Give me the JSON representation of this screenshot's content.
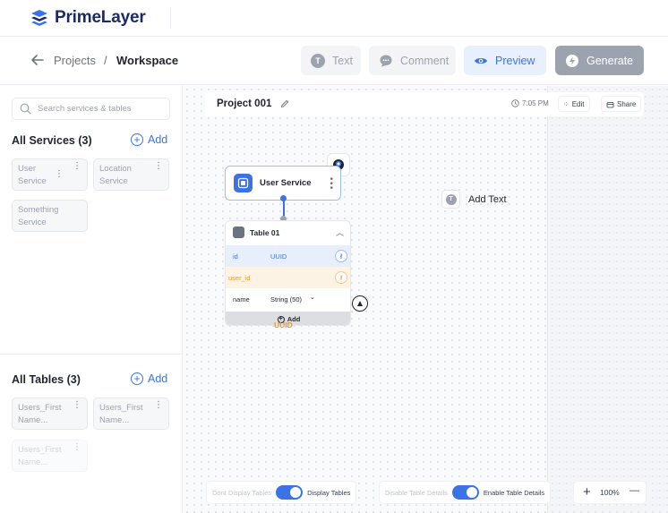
{
  "app": {
    "name": "PrimeLayer"
  },
  "breadcrumb": {
    "projects": "Projects",
    "separator": "/",
    "current": "Workspace"
  },
  "toolbar": {
    "text_label": "Text",
    "comment_label": "Comment",
    "preview_label": "Preview",
    "generate_label": "Generate"
  },
  "sidebar": {
    "search_placeholder": "Search services & tables",
    "services_title": "All Services (3)",
    "services_add": "Add",
    "services": [
      {
        "line1": "User",
        "line2": "Service"
      },
      {
        "line1": "Location",
        "line2": "Service"
      },
      {
        "line1": "Something",
        "line2": "Service"
      }
    ],
    "tables_title": "All Tables (3)",
    "tables_add": "Add",
    "tables": [
      {
        "line1": "Users_First",
        "line2": "Name..."
      },
      {
        "line1": "Users_First",
        "line2": "Name..."
      },
      {
        "line1": "Users_First",
        "line2": "Name..."
      }
    ]
  },
  "canvas": {
    "project_title": "Project 001",
    "time": "7:05 PM",
    "edit_label": "Edit",
    "share_label": "Share",
    "service_node": {
      "label": "User Service"
    },
    "table_node": {
      "title": "Table 01",
      "rows": [
        {
          "name": "id",
          "type": "UUID"
        },
        {
          "name": "user_id",
          "type": ""
        },
        {
          "name": "name",
          "type": "String (50)"
        }
      ],
      "add_label": "Add",
      "ghost_type": "UUID"
    },
    "add_text_label": "Add Text",
    "toggle_tables": {
      "off_label": "Dont Display Tables",
      "on_label": "Display Tables"
    },
    "toggle_details": {
      "off_label": "Disable Table Details",
      "on_label": "Enable Table Details"
    },
    "zoom": {
      "value": "100%",
      "minus": "—",
      "plus": "+"
    }
  },
  "colors": {
    "accent": "#3b73e6",
    "brand": "#1d2b64",
    "foreign_key": "#e79a2b"
  }
}
